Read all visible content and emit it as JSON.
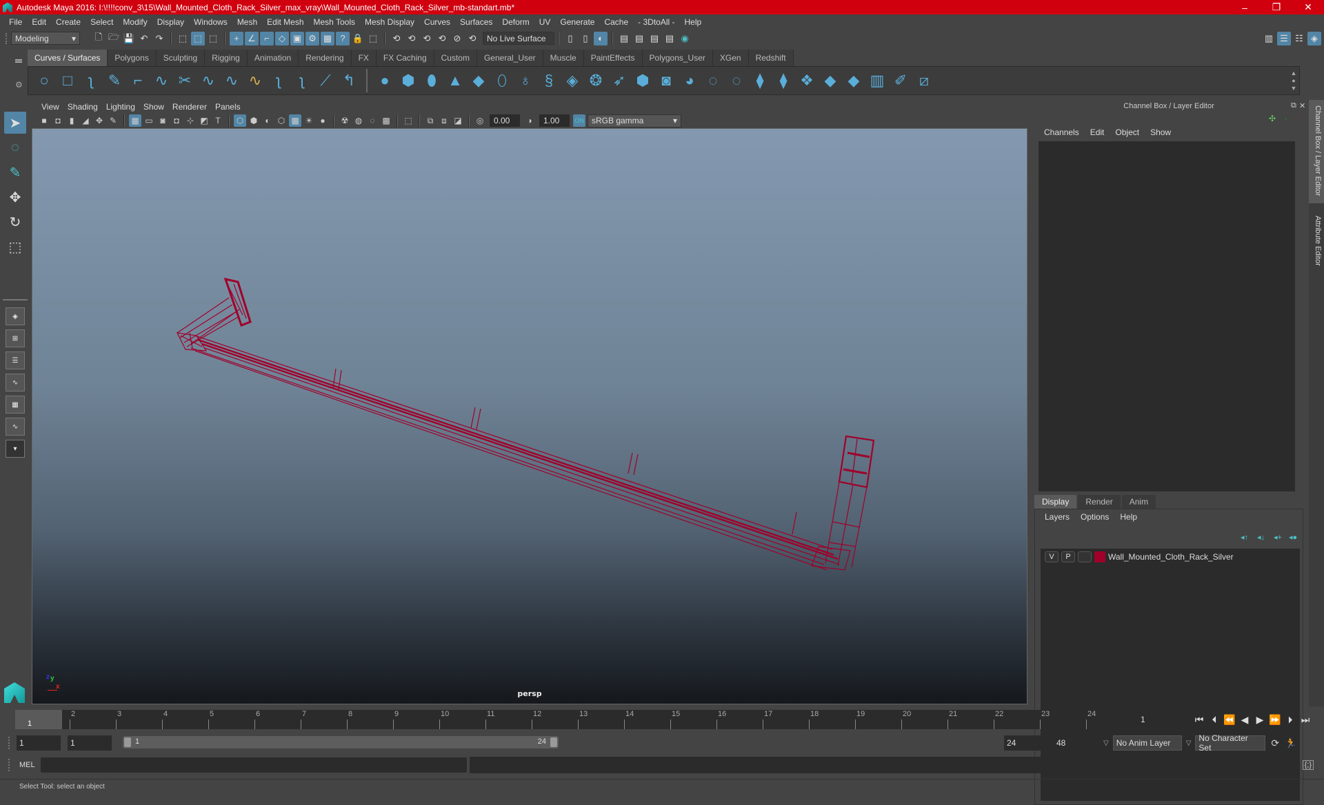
{
  "window": {
    "title": "Autodesk Maya 2016: I:\\!!!!conv_3\\15\\Wall_Mounted_Cloth_Rack_Silver_max_vray\\Wall_Mounted_Cloth_Rack_Silver_mb-standart.mb*",
    "minimize": "–",
    "maximize": "❐",
    "close": "✕"
  },
  "menubar": [
    "File",
    "Edit",
    "Create",
    "Select",
    "Modify",
    "Display",
    "Windows",
    "Mesh",
    "Edit Mesh",
    "Mesh Tools",
    "Mesh Display",
    "Curves",
    "Surfaces",
    "Deform",
    "UV",
    "Generate",
    "Cache",
    "- 3DtoAll -",
    "Help"
  ],
  "statusline": {
    "mode": "Modeling",
    "live_surface": "No Live Surface"
  },
  "shelf": {
    "tabs": [
      "Curves / Surfaces",
      "Polygons",
      "Sculpting",
      "Rigging",
      "Animation",
      "Rendering",
      "FX",
      "FX Caching",
      "Custom",
      "General_User",
      "Muscle",
      "PaintEffects",
      "Polygons_User",
      "XGen",
      "Redshift"
    ],
    "active_tab": "Curves / Surfaces"
  },
  "viewport": {
    "menu": [
      "View",
      "Shading",
      "Lighting",
      "Show",
      "Renderer",
      "Panels"
    ],
    "exposure": "0.00",
    "gamma": "1.00",
    "color_space": "sRGB gamma",
    "camera": "persp",
    "object_color": "#a0002a"
  },
  "channel_box": {
    "title": "Channel Box / Layer Editor",
    "menu": [
      "Channels",
      "Edit",
      "Object",
      "Show"
    ]
  },
  "layer_editor": {
    "tabs": [
      "Display",
      "Render",
      "Anim"
    ],
    "active_tab": "Display",
    "menu": [
      "Layers",
      "Options",
      "Help"
    ],
    "layers": [
      {
        "visible": "V",
        "playback": "P",
        "color": "#a0002a",
        "name": "Wall_Mounted_Cloth_Rack_Silver"
      }
    ]
  },
  "side_tabs": [
    "Channel Box / Layer Editor",
    "Attribute Editor"
  ],
  "timeline": {
    "ticks": [
      "1",
      "2",
      "3",
      "4",
      "5",
      "6",
      "7",
      "8",
      "9",
      "10",
      "11",
      "12",
      "13",
      "14",
      "15",
      "16",
      "17",
      "18",
      "19",
      "20",
      "21",
      "22",
      "23",
      "24"
    ],
    "current_frame": "1",
    "current_frame_field": "1"
  },
  "range": {
    "start": "1",
    "playback_start": "1",
    "slider_start": "1",
    "slider_end": "24",
    "playback_end": "24",
    "end": "48",
    "anim_layer": "No Anim Layer",
    "character_set": "No Character Set"
  },
  "command": {
    "label": "MEL"
  },
  "help_line": "Select Tool: select an object"
}
